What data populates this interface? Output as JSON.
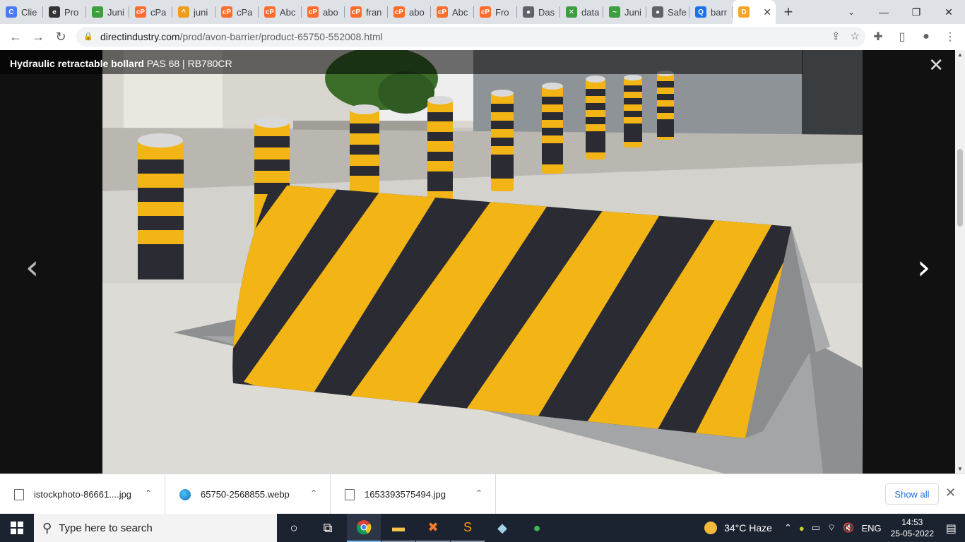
{
  "tabs": [
    {
      "icon": "c-blue-icon",
      "label": "Clie",
      "color": "#4a7bf7",
      "glyph": "C"
    },
    {
      "icon": "e-script-icon",
      "label": "Pro",
      "color": "#333333",
      "glyph": "e"
    },
    {
      "icon": "leaf-icon",
      "label": "Juni",
      "color": "#3e9d3e",
      "glyph": "~"
    },
    {
      "icon": "cpanel-icon",
      "label": "cPa",
      "color": "#ff6c2c",
      "glyph": "cP"
    },
    {
      "icon": "pma-icon",
      "label": "juni",
      "color": "#f29c1f",
      "glyph": "^"
    },
    {
      "icon": "cpanel-icon",
      "label": "cPa",
      "color": "#ff6c2c",
      "glyph": "cP"
    },
    {
      "icon": "cpanel-icon",
      "label": "Abc",
      "color": "#ff6c2c",
      "glyph": "cP"
    },
    {
      "icon": "cpanel-icon",
      "label": "abo",
      "color": "#ff6c2c",
      "glyph": "cP"
    },
    {
      "icon": "cpanel-icon",
      "label": "fran",
      "color": "#ff6c2c",
      "glyph": "cP"
    },
    {
      "icon": "cpanel-icon",
      "label": "abo",
      "color": "#ff6c2c",
      "glyph": "cP"
    },
    {
      "icon": "cpanel-icon",
      "label": "Abc",
      "color": "#ff6c2c",
      "glyph": "cP"
    },
    {
      "icon": "cpanel-icon",
      "label": "Fro",
      "color": "#ff6c2c",
      "glyph": "cP"
    },
    {
      "icon": "globe-icon",
      "label": "Das",
      "color": "#5f6368",
      "glyph": "●"
    },
    {
      "icon": "data-icon",
      "label": "data",
      "color": "#3e9d3e",
      "glyph": "✕"
    },
    {
      "icon": "leaf-icon",
      "label": "Juni",
      "color": "#3e9d3e",
      "glyph": "~"
    },
    {
      "icon": "globe-icon",
      "label": "Safe",
      "color": "#5f6368",
      "glyph": "●"
    },
    {
      "icon": "search-icon",
      "label": "barr",
      "color": "#1a73e8",
      "glyph": "Q"
    },
    {
      "icon": "directindustry-icon",
      "label": "",
      "color": "#f5a623",
      "glyph": "D",
      "active": true
    }
  ],
  "toolbar": {
    "url_host": "directindustry.com",
    "url_path": "/prod/avon-barrier/product-65750-552008.html"
  },
  "viewer": {
    "title_bold": "Hydraulic retractable bollard",
    "title_rest": " PAS 68 | RB780CR",
    "close": "✕",
    "prev": "‹",
    "next": "›"
  },
  "downloads": {
    "items": [
      {
        "filename": "istockphoto-86661....jpg",
        "icon": "file-icon"
      },
      {
        "filename": "65750-2568855.webp",
        "icon": "edge-icon"
      },
      {
        "filename": "1653393575494.jpg",
        "icon": "file-icon"
      }
    ],
    "show_all": "Show all"
  },
  "taskbar": {
    "search_placeholder": "Type here to search",
    "weather": "34°C  Haze",
    "lang": "ENG",
    "time": "14:53",
    "date": "25-05-2022"
  },
  "colors": {
    "stripe_yellow": "#f3b416",
    "stripe_black": "#2a2b33",
    "accent_blue": "#1a73e8"
  }
}
